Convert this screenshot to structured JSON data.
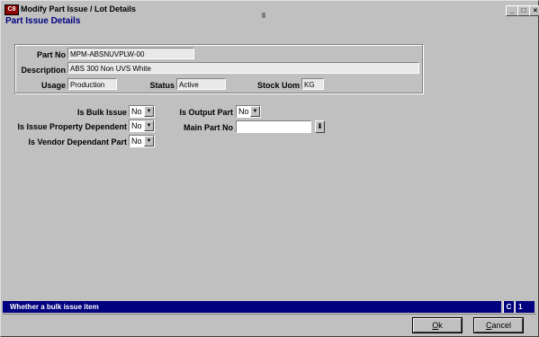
{
  "window": {
    "app_icon_text": "C8",
    "title": "Modify Part Issue / Lot Details",
    "controls": {
      "minimize": "_",
      "maximize": "□",
      "close": "×"
    }
  },
  "section_title": "Part Issue Details",
  "details": {
    "part_no_label": "Part No",
    "part_no_value": "MPM-ABSNUVPLW-00",
    "description_label": "Description",
    "description_value": "ABS 300 Non UVS White",
    "usage_label": "Usage",
    "usage_value": "Production",
    "status_label": "Status",
    "status_value": "Active",
    "stock_uom_label": "Stock Uom",
    "stock_uom_value": "KG"
  },
  "options": {
    "is_bulk_issue_label": "Is Bulk Issue",
    "is_bulk_issue_value": "No",
    "is_issue_property_dependent_label": "Is Issue Property Dependent",
    "is_issue_property_dependent_value": "No",
    "is_vendor_dependant_part_label": "Is Vendor Dependant Part",
    "is_vendor_dependant_part_value": "No",
    "is_output_part_label": "Is Output Part",
    "is_output_part_value": "No",
    "main_part_no_label": "Main Part No",
    "main_part_no_value": ""
  },
  "status_bar": {
    "message": "Whether a bulk issue item",
    "cell_1": "C",
    "cell_2": "1"
  },
  "buttons": {
    "ok_prefix": "O",
    "ok_rest": "k",
    "cancel_prefix": "C",
    "cancel_rest": "ancel"
  }
}
